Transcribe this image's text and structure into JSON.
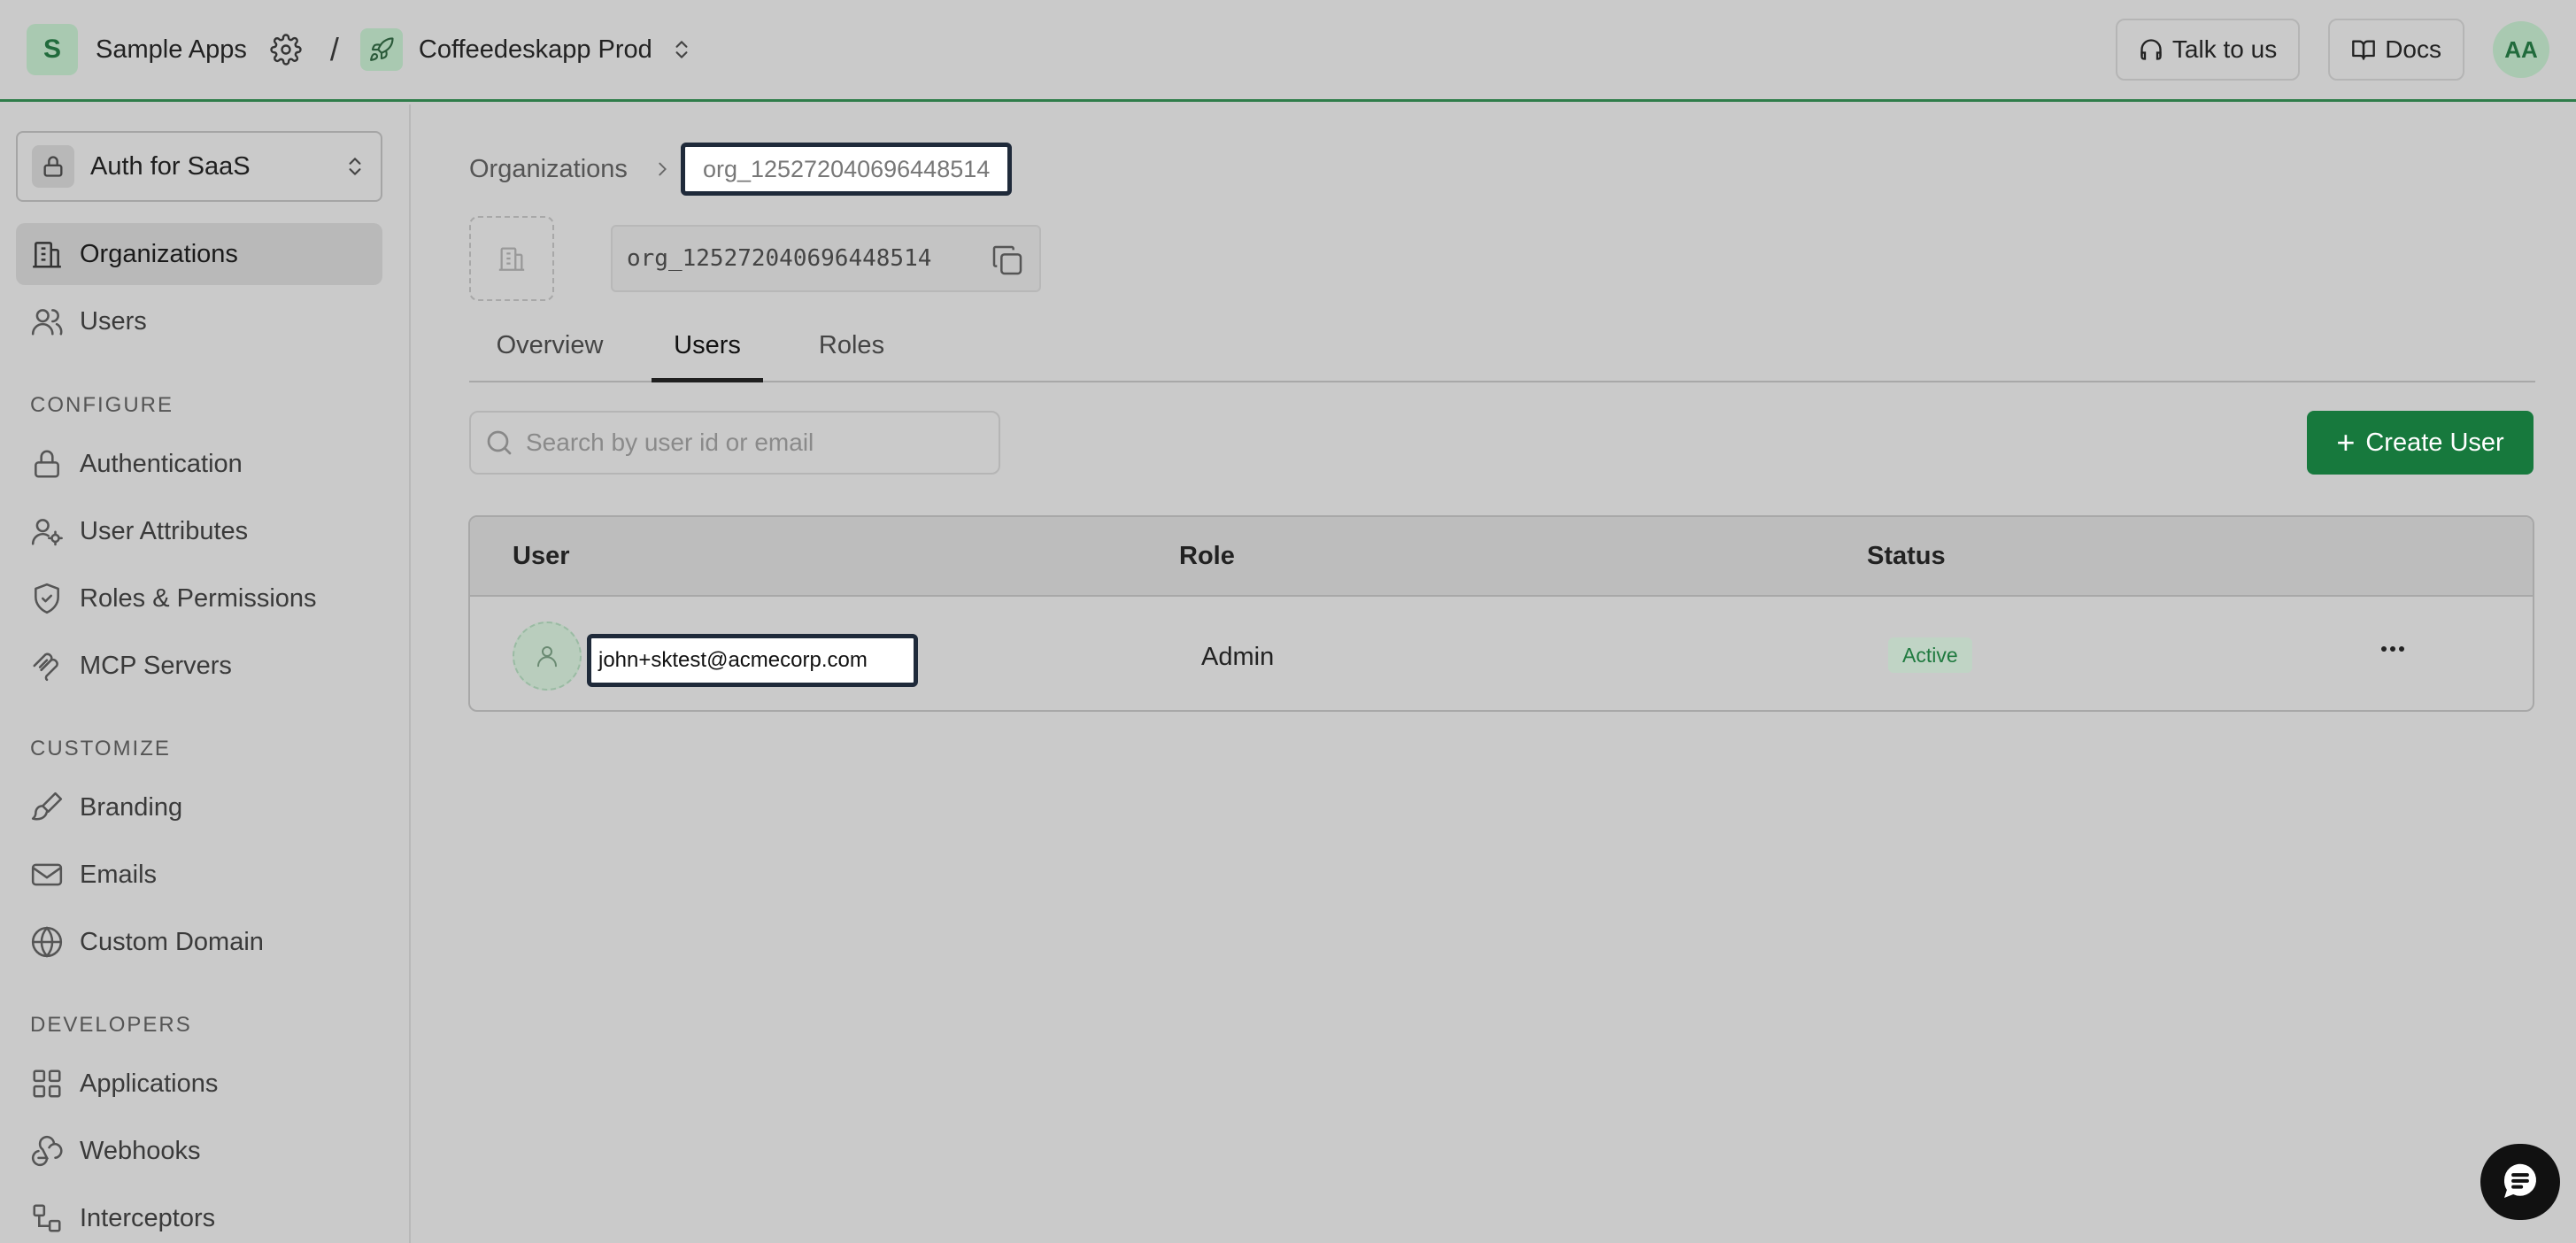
{
  "topbar": {
    "workspace_initial": "S",
    "workspace_name": "Sample Apps",
    "separator": "/",
    "environment_name": "Coffeedeskapp Prod",
    "talk_label": "Talk to us",
    "docs_label": "Docs",
    "user_initials": "AA"
  },
  "sidebar": {
    "app_selector": "Auth for SaaS",
    "items_top": [
      {
        "label": "Organizations",
        "icon": "building-icon",
        "active": true
      },
      {
        "label": "Users",
        "icon": "users-icon",
        "active": false
      }
    ],
    "configure_label": "CONFIGURE",
    "configure_items": [
      {
        "label": "Authentication",
        "icon": "lock-icon"
      },
      {
        "label": "User Attributes",
        "icon": "user-gear-icon"
      },
      {
        "label": "Roles & Permissions",
        "icon": "shield-icon"
      },
      {
        "label": "MCP Servers",
        "icon": "mcp-icon"
      }
    ],
    "customize_label": "CUSTOMIZE",
    "customize_items": [
      {
        "label": "Branding",
        "icon": "brush-icon"
      },
      {
        "label": "Emails",
        "icon": "mail-icon"
      },
      {
        "label": "Custom Domain",
        "icon": "globe-icon"
      }
    ],
    "developers_label": "DEVELOPERS",
    "developers_items": [
      {
        "label": "Applications",
        "icon": "grid-icon"
      },
      {
        "label": "Webhooks",
        "icon": "webhook-icon"
      },
      {
        "label": "Interceptors",
        "icon": "interceptor-icon"
      }
    ]
  },
  "main": {
    "breadcrumb": {
      "root": "Organizations",
      "current": "org_125272040696448514"
    },
    "org_id": "org_125272040696448514",
    "tabs": [
      {
        "label": "Overview",
        "active": false
      },
      {
        "label": "Users",
        "active": true
      },
      {
        "label": "Roles",
        "active": false
      }
    ],
    "search_placeholder": "Search by user id or email",
    "create_button": "Create User",
    "table": {
      "headers": [
        "User",
        "Role",
        "Status"
      ],
      "rows": [
        {
          "email": "john+sktest@acmecorp.com",
          "role": "Admin",
          "status": "Active"
        }
      ]
    }
  },
  "colors": {
    "accent_green": "#17793d",
    "background": "#cacaca",
    "status_active": "#1f7a3f"
  }
}
